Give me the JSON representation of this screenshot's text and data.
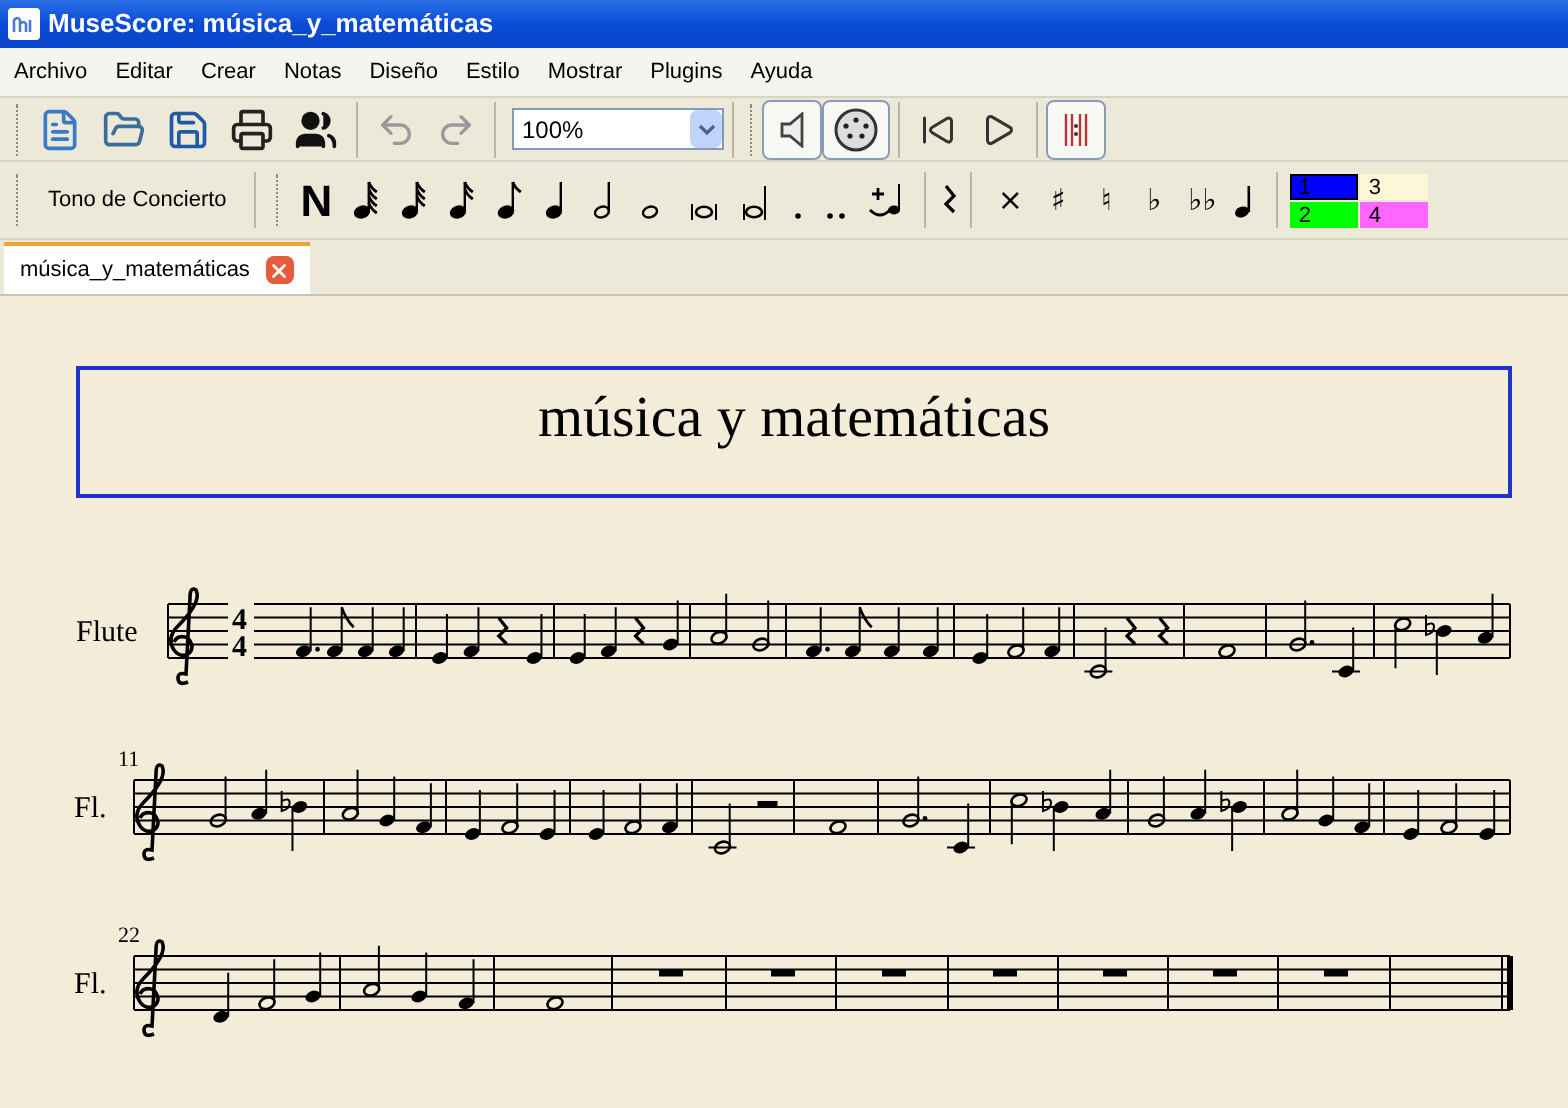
{
  "window": {
    "title": "MuseScore: música_y_matemáticas"
  },
  "menu": [
    "Archivo",
    "Editar",
    "Crear",
    "Notas",
    "Diseño",
    "Estilo",
    "Mostrar",
    "Plugins",
    "Ayuda"
  ],
  "toolbar": {
    "zoom": "100%",
    "sound_on": true,
    "midi_on": true,
    "repeat_on": true
  },
  "note_toolbar": {
    "concert_pitch": "Tono de Concierto",
    "note_input": "N",
    "accidentals": [
      "×",
      "♯",
      "♮",
      "♭",
      "♭♭"
    ],
    "voices": [
      {
        "label": "1",
        "color": "#0000ff",
        "selected": true
      },
      {
        "label": "3",
        "color": "#fff8d8",
        "selected": false
      },
      {
        "label": "2",
        "color": "#00ff00",
        "selected": false
      },
      {
        "label": "4",
        "color": "#ff66ff",
        "selected": false
      }
    ]
  },
  "tabs": [
    {
      "label": "música_y_matemáticas",
      "selected": true
    }
  ],
  "score": {
    "title": "música y matemáticas",
    "time_signature": {
      "numerator": "4",
      "denominator": "4"
    },
    "systems": [
      {
        "instrument": "Flute"
      },
      {
        "instrument": "Fl.",
        "measure_number": "11"
      },
      {
        "instrument": "Fl.",
        "measure_number": "22"
      }
    ]
  }
}
